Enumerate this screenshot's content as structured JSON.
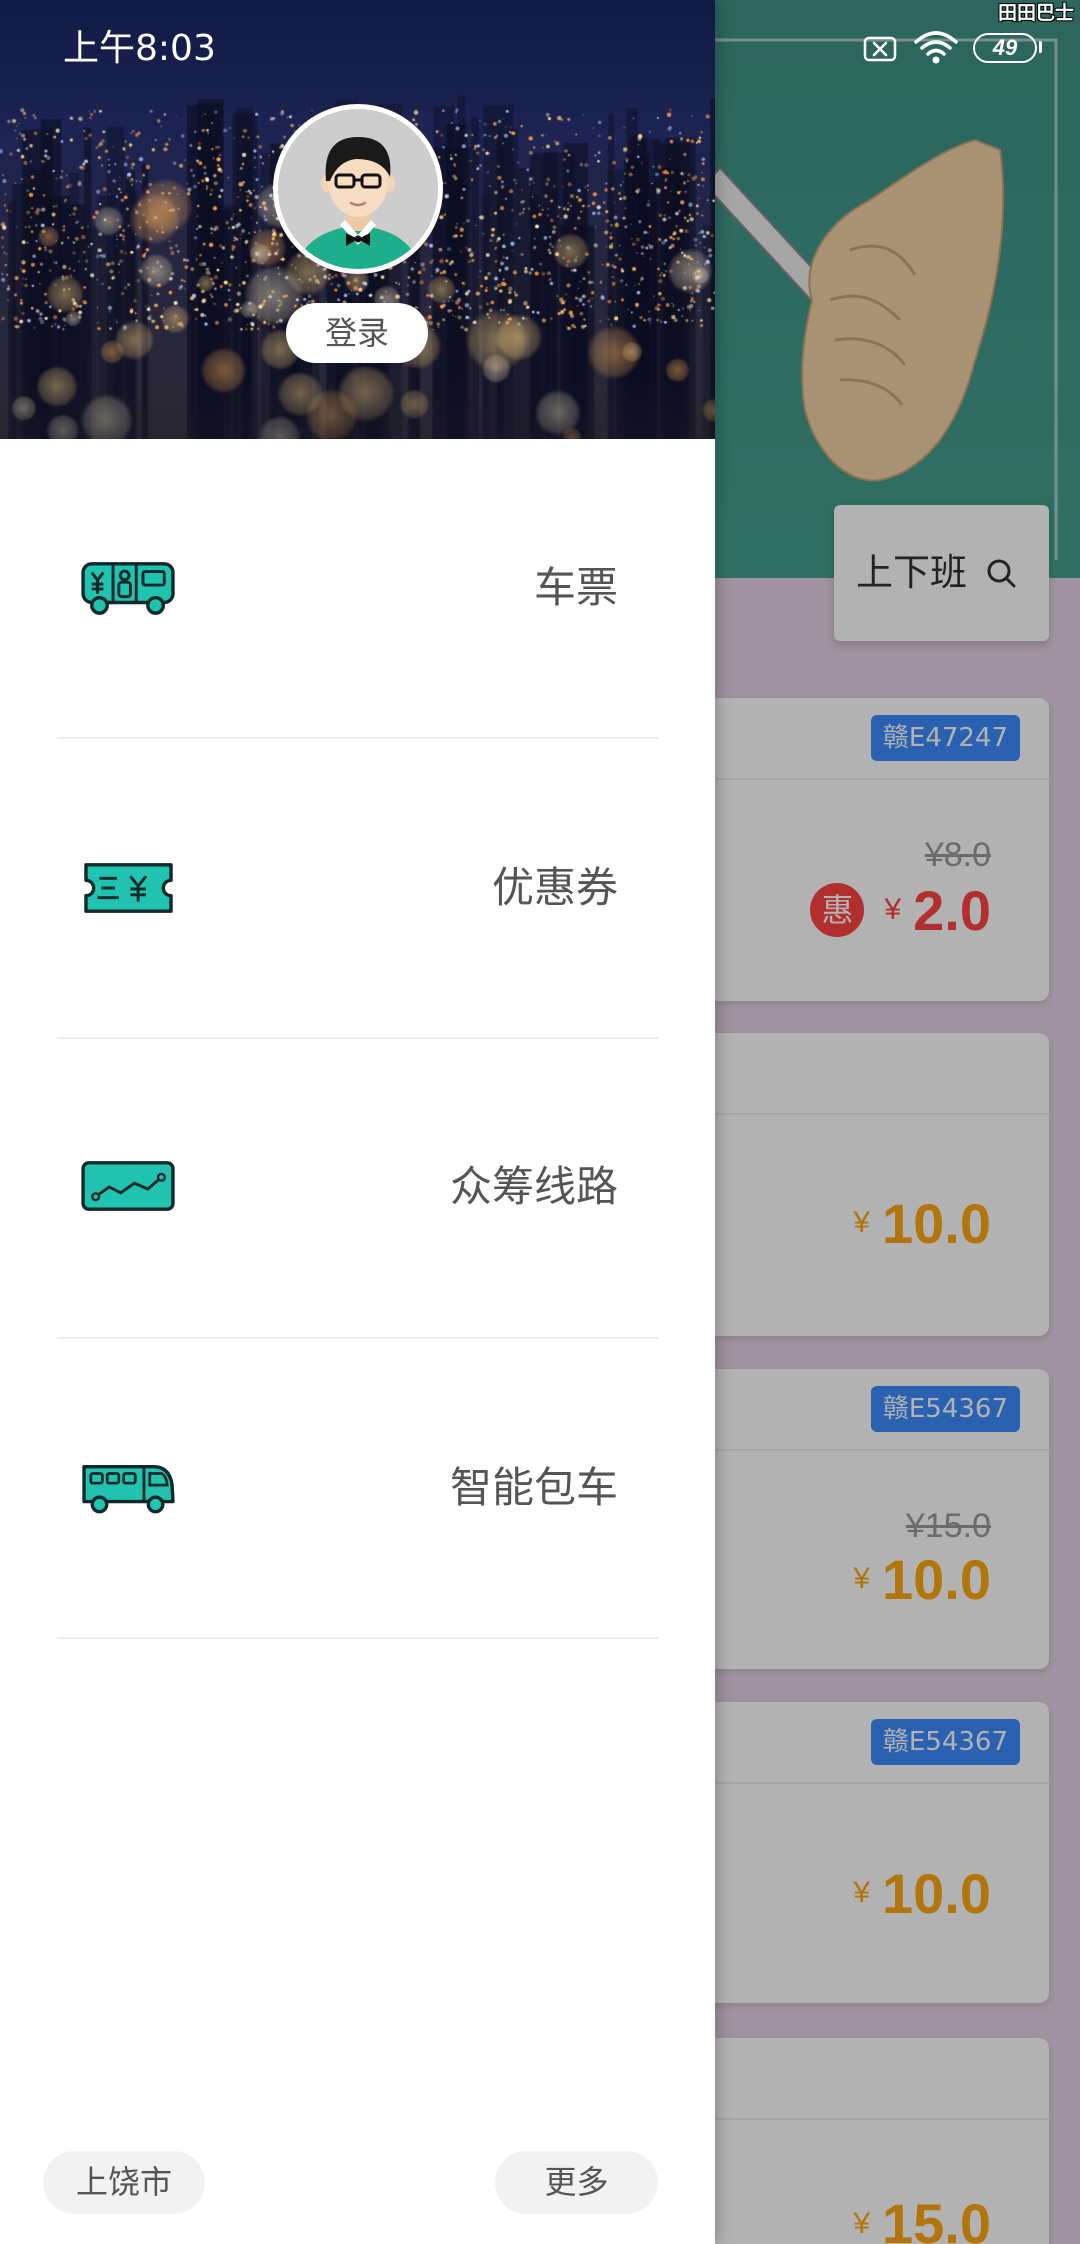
{
  "status_bar": {
    "time": "上午8:03",
    "battery_level": "49",
    "icons": [
      "notification-cleared-icon",
      "wifi-icon",
      "battery-icon"
    ]
  },
  "watermark": "田田巴士",
  "drawer": {
    "header": {
      "avatar_icon": "avatar",
      "login_label": "登录"
    },
    "menu": [
      {
        "label": "车票",
        "icon": "bus-ticket-icon"
      },
      {
        "label": "优惠券",
        "icon": "coupon-icon"
      },
      {
        "label": "众筹线路",
        "icon": "crowdfund-route-icon"
      },
      {
        "label": "智能包车",
        "icon": "bus-charter-icon"
      }
    ],
    "footer": {
      "city_label": "上饶市",
      "more_label": "更多"
    }
  },
  "main": {
    "search": {
      "label": "上下班",
      "icon": "search-icon"
    },
    "cards": [
      {
        "plate": "赣E47247",
        "original_price": "¥8.0",
        "discount_tag": "惠",
        "currency": "¥",
        "price": "2.0"
      },
      {
        "currency": "¥",
        "price": "10.0"
      },
      {
        "plate": "赣E54367",
        "original_price": "¥15.0",
        "currency": "¥",
        "price": "10.0"
      },
      {
        "plate": "赣E54367",
        "currency": "¥",
        "price": "10.0"
      },
      {
        "currency": "¥",
        "price": "15.0"
      }
    ]
  },
  "colors": {
    "accent_teal": "#1fc3b0",
    "icon_outline": "#10282a",
    "price_orange": "#ffa812",
    "price_red": "#ff4444",
    "plate_badge_blue": "#3d8bfd",
    "scrim": "rgba(0,0,0,0.3)"
  }
}
